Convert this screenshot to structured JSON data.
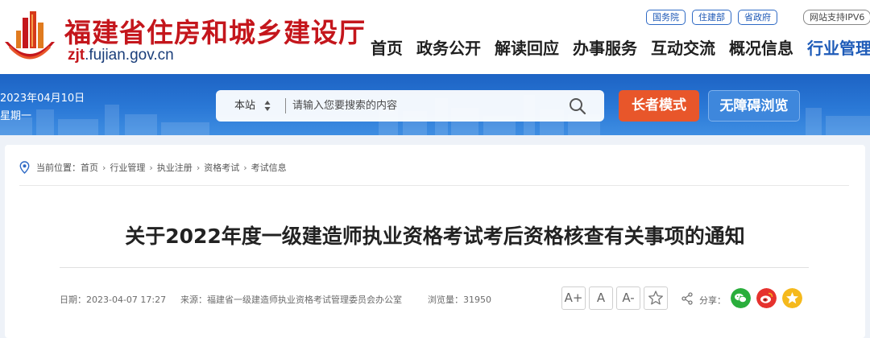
{
  "header": {
    "site_name": "福建省住房和城乡建设厅",
    "domain_prefix": "zjt",
    "domain_suffix": ".fujian.gov.cn",
    "top_links": [
      "国务院",
      "住建部",
      "省政府"
    ],
    "ipv6": "网站支持IPV6",
    "nav": [
      "首页",
      "政务公开",
      "解读回应",
      "办事服务",
      "互动交流",
      "概况信息",
      "行业管理"
    ],
    "active_nav": "行业管理"
  },
  "banner": {
    "date": "2023年04月10日",
    "weekday": "星期一",
    "search_scope": "本站",
    "search_placeholder": "请输入您要搜索的内容",
    "elder_mode": "长者模式",
    "accessible": "无障碍浏览"
  },
  "breadcrumb": {
    "label": "当前位置：",
    "items": [
      "首页",
      "行业管理",
      "执业注册",
      "资格考试",
      "考试信息"
    ]
  },
  "article": {
    "title": "关于2022年度一级建造师执业资格考试考后资格核查有关事项的通知",
    "date_label": "日期：",
    "date": "2023-04-07 17:27",
    "source_label": "来源：",
    "source": "福建省一级建造师执业资格考试管理委员会办公室",
    "views_label": "浏览量：",
    "views": "31950",
    "font_large": "A+",
    "font_normal": "A",
    "font_small": "A-",
    "share_label": "分享："
  },
  "colors": {
    "brand_red": "#c4161c",
    "brand_blue": "#1e5bb8",
    "elder_orange": "#e8562a",
    "wechat_green": "#2aae3c",
    "weibo_red": "#e6322e",
    "qzone_yellow": "#f5b91c"
  }
}
